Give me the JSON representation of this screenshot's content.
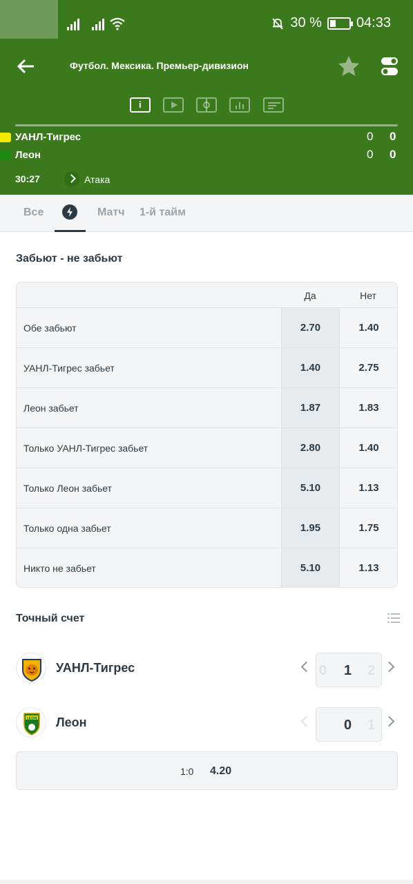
{
  "status_bar": {
    "battery_percent": "30 %",
    "battery_level": 0.3,
    "time": "04:33"
  },
  "header": {
    "title": "Футбол. Мексика. Премьер-дивизион",
    "icons": [
      "back-arrow-icon",
      "star-icon",
      "toggle-icon"
    ],
    "view_tabs": [
      "info-icon",
      "video-icon",
      "field-icon",
      "stats-icon",
      "scoreboard-icon"
    ],
    "teams": [
      {
        "name": "УАНЛ-Тигрес",
        "score_half": "0",
        "score_total": "0",
        "color": "#f4e800"
      },
      {
        "name": "Леон",
        "score_half": "0",
        "score_total": "0",
        "color": "#1c8a12"
      }
    ],
    "match_time": "30:27",
    "event": "Атака"
  },
  "filter_tabs": {
    "all": "Все",
    "match": "Матч",
    "first_half": "1-й тайм"
  },
  "market": {
    "title": "Забьют - не забьют",
    "col_yes": "Да",
    "col_no": "Нет",
    "rows": [
      {
        "label": "Обе забьют",
        "yes": "2.70",
        "no": "1.40"
      },
      {
        "label": "УАНЛ-Тигрес забьет",
        "yes": "1.40",
        "no": "2.75"
      },
      {
        "label": "Леон забьет",
        "yes": "1.87",
        "no": "1.83"
      },
      {
        "label": "Только УАНЛ-Тигрес забьет",
        "yes": "2.80",
        "no": "1.40"
      },
      {
        "label": "Только Леон забьет",
        "yes": "5.10",
        "no": "1.13"
      },
      {
        "label": "Только одна забьет",
        "yes": "1.95",
        "no": "1.75"
      },
      {
        "label": "Никто не забьет",
        "yes": "5.10",
        "no": "1.13"
      }
    ]
  },
  "correct_score": {
    "title": "Точный счет",
    "home": {
      "name": "УАНЛ-Тигрес",
      "prev": "0",
      "current": "1",
      "next": "2"
    },
    "away": {
      "name": "Леон",
      "current": "0",
      "next": "1"
    },
    "selected_score": "1:0",
    "selected_odds": "4.20"
  },
  "colors": {
    "header_green": "#3a7a1d",
    "text_dark": "#2b3a44",
    "cell_bg": "#e8ebed"
  }
}
